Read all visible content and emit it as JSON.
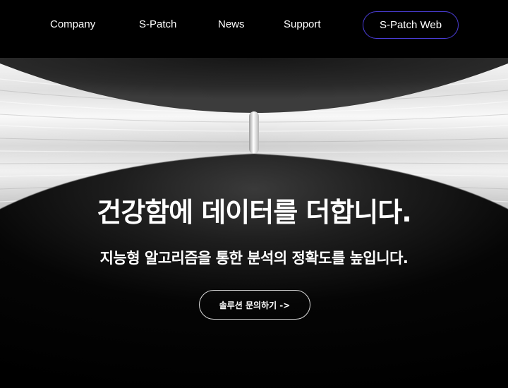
{
  "nav": {
    "items": [
      {
        "label": "Company"
      },
      {
        "label": "S-Patch"
      },
      {
        "label": "News"
      },
      {
        "label": "Support"
      }
    ],
    "web_button_label": "S-Patch Web",
    "web_button_border_color": "#4a3dd6"
  },
  "hero": {
    "title": "건강함에 데이터를 더합니다.",
    "subtitle": "지능형 알고리즘을 통한 분석의 정확도를 높입니다.",
    "cta_label": "솔루션 문의하기 ->"
  },
  "colors": {
    "background": "#000000",
    "text": "#ffffff",
    "cta_border": "#d9d9d9"
  }
}
